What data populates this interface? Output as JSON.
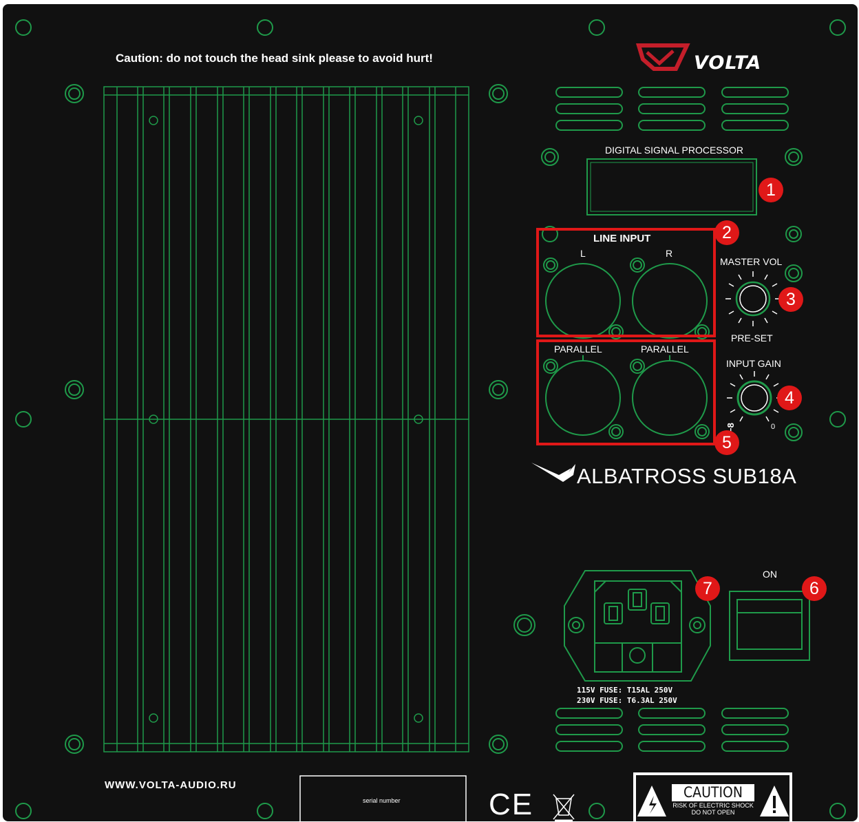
{
  "panel": {
    "caution_top": "Caution: do not touch the head sink please to avoid hurt!",
    "brand": "VOLTA",
    "dsp_title": "DIGITAL SIGNAL PROCESSOR",
    "line_input": "LINE INPUT",
    "input_l": "L",
    "input_r": "R",
    "master_vol": "MASTER VOL",
    "preset": "PRE-SET",
    "parallel_left": "PARALLEL",
    "parallel_right": "PARALLEL",
    "input_gain": "INPUT GAIN",
    "gain_min": "−8",
    "gain_max": "0",
    "model": "ALBATROSS SUB18A",
    "power_on": "ON",
    "fuse_115": "115V FUSE:  T15AL  250V",
    "fuse_230": "230V FUSE:  T6.3AL  250V",
    "website": "WWW.VOLTA-AUDIO.RU",
    "serial_label": "serial number",
    "ce_mark": "CE",
    "caution_label": "CAUTION",
    "caution_line1": "RISK OF ELECTRIC SHOCK",
    "caution_line2": "DO NOT OPEN"
  },
  "markers": [
    "1",
    "2",
    "3",
    "4",
    "5",
    "6",
    "7"
  ],
  "colors": {
    "panel_bg": "#111111",
    "line_green": "#1f9a4a",
    "marker_red": "#e01818",
    "highlight_red": "#e01818",
    "logo_red": "#c41e2a"
  },
  "icons": [
    "screw-hole-icon",
    "xlr-connector-icon",
    "knob-icon",
    "iec-power-inlet-icon",
    "rocker-switch-icon",
    "albatross-bird-icon",
    "weee-bin-icon",
    "lightning-warning-icon",
    "exclamation-warning-icon"
  ]
}
